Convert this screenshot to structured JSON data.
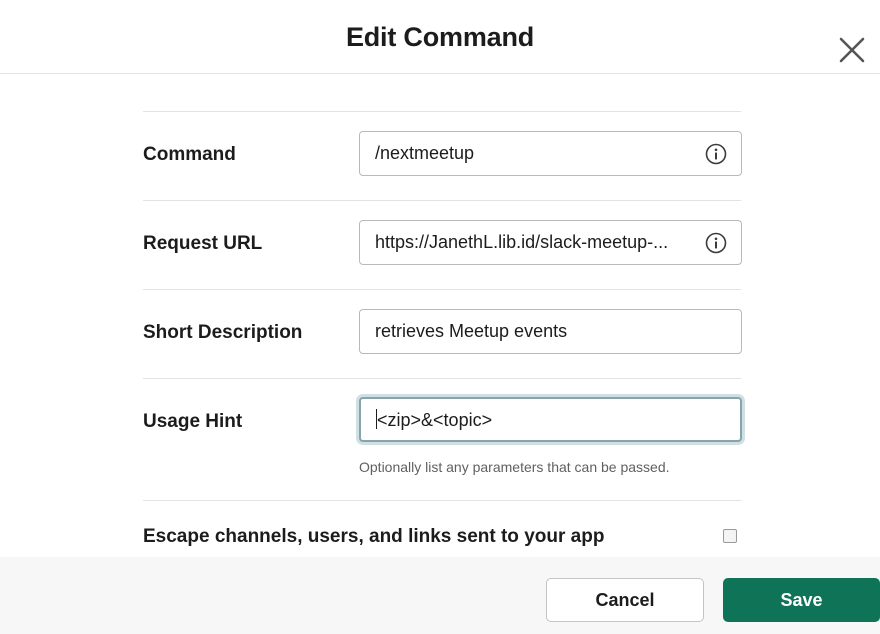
{
  "dialog": {
    "title": "Edit Command"
  },
  "fields": {
    "command": {
      "label": "Command",
      "value": "/nextmeetup"
    },
    "request_url": {
      "label": "Request URL",
      "value": "https://JanethL.lib.id/slack-meetup-..."
    },
    "short_description": {
      "label": "Short Description",
      "value": "retrieves Meetup events"
    },
    "usage_hint": {
      "label": "Usage Hint",
      "value": "<zip>&<topic>",
      "help": "Optionally list any parameters that can be passed."
    }
  },
  "escape": {
    "label": "Escape channels, users, and links sent to your app",
    "checked": false
  },
  "footer": {
    "cancel_label": "Cancel",
    "save_label": "Save"
  },
  "colors": {
    "save_button": "#0f7457",
    "focus_ring": "#88a3a9"
  },
  "icons": {
    "close": "close-icon",
    "info": "info-icon"
  }
}
